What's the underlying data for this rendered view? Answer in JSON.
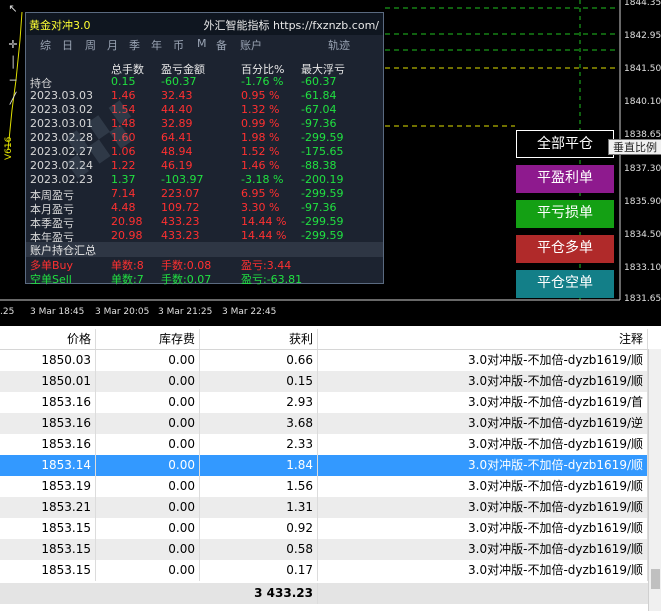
{
  "chart": {
    "price_axis": [
      "1844.35",
      "1842.95",
      "1841.50",
      "1840.10",
      "1838.65",
      "1837.30",
      "1835.90",
      "1834.50",
      "1833.10",
      "1831.65"
    ],
    "time_axis": [
      ".25",
      "3 Mar 18:45",
      "3 Mar 20:05",
      "3 Mar 21:25",
      "3 Mar 22:45"
    ],
    "vertical_label": "V616"
  },
  "panel": {
    "title": "黄金对冲3.0",
    "brand": "外汇智能指标 https://fxznzb.com/",
    "tabs": [
      "综",
      "日",
      "周",
      "月",
      "季",
      "年",
      "币",
      "M",
      "备",
      "账户",
      "轨迹"
    ],
    "headers": [
      "总手数",
      "盈亏金额",
      "百分比%",
      "最大浮亏"
    ],
    "position_label": "持仓",
    "rows": [
      {
        "label": "持仓",
        "lots": "0.15",
        "pnl": "-60.37",
        "pct": "-1.76 %",
        "maxdd": "-60.37",
        "color": "green"
      },
      {
        "label": "2023.03.03",
        "lots": "1.46",
        "pnl": "32.43",
        "pct": "0.95 %",
        "maxdd": "-61.84",
        "color": "red"
      },
      {
        "label": "2023.03.02",
        "lots": "1.54",
        "pnl": "44.40",
        "pct": "1.32 %",
        "maxdd": "-67.04",
        "color": "red"
      },
      {
        "label": "2023.03.01",
        "lots": "1.48",
        "pnl": "32.89",
        "pct": "0.99 %",
        "maxdd": "-97.36",
        "color": "red"
      },
      {
        "label": "2023.02.28",
        "lots": "1.60",
        "pnl": "64.41",
        "pct": "1.98 %",
        "maxdd": "-299.59",
        "color": "red"
      },
      {
        "label": "2023.02.27",
        "lots": "1.06",
        "pnl": "48.94",
        "pct": "1.52 %",
        "maxdd": "-175.65",
        "color": "red"
      },
      {
        "label": "2023.02.24",
        "lots": "1.22",
        "pnl": "46.19",
        "pct": "1.46 %",
        "maxdd": "-88.38",
        "color": "red"
      },
      {
        "label": "2023.02.23",
        "lots": "1.37",
        "pnl": "-103.97",
        "pct": "-3.18 %",
        "maxdd": "-200.19",
        "color": "green"
      },
      {
        "label": "本周盈亏",
        "lots": "7.14",
        "pnl": "223.07",
        "pct": "6.95 %",
        "maxdd": "-299.59",
        "color": "red"
      },
      {
        "label": "本月盈亏",
        "lots": "4.48",
        "pnl": "109.72",
        "pct": "3.30 %",
        "maxdd": "-97.36",
        "color": "red"
      },
      {
        "label": "本季盈亏",
        "lots": "20.98",
        "pnl": "433.23",
        "pct": "14.44 %",
        "maxdd": "-299.59",
        "color": "red"
      },
      {
        "label": "本年盈亏",
        "lots": "20.98",
        "pnl": "433.23",
        "pct": "14.44 %",
        "maxdd": "-299.59",
        "color": "red"
      }
    ],
    "summary_title": "账户持仓汇总",
    "buy": {
      "label": "多单Buy",
      "count": "单数:8",
      "lots": "手数:0.08",
      "pnl": "盈亏:3.44"
    },
    "sell": {
      "label": "空单Sell",
      "count": "单数:7",
      "lots": "手数:0.07",
      "pnl": "盈亏:-63.81"
    }
  },
  "buttons": {
    "close_all": "全部平仓",
    "close_profit": "平盈利单",
    "close_loss": "平亏损单",
    "close_buy": "平仓多单",
    "close_sell": "平仓空单"
  },
  "tooltip": "垂直比例",
  "grid": {
    "headers": [
      "价格",
      "库存费",
      "获利",
      "注释"
    ],
    "rows": [
      [
        "1850.03",
        "0.00",
        "0.66",
        "3.0对冲版-不加倍-dyzb1619/顺"
      ],
      [
        "1850.01",
        "0.00",
        "0.15",
        "3.0对冲版-不加倍-dyzb1619/顺"
      ],
      [
        "1853.16",
        "0.00",
        "2.93",
        "3.0对冲版-不加倍-dyzb1619/首"
      ],
      [
        "1853.16",
        "0.00",
        "3.68",
        "3.0对冲版-不加倍-dyzb1619/逆"
      ],
      [
        "1853.16",
        "0.00",
        "2.33",
        "3.0对冲版-不加倍-dyzb1619/顺"
      ],
      [
        "1853.14",
        "0.00",
        "1.84",
        "3.0对冲版-不加倍-dyzb1619/顺"
      ],
      [
        "1853.19",
        "0.00",
        "1.56",
        "3.0对冲版-不加倍-dyzb1619/顺"
      ],
      [
        "1853.21",
        "0.00",
        "1.31",
        "3.0对冲版-不加倍-dyzb1619/顺"
      ],
      [
        "1853.15",
        "0.00",
        "0.92",
        "3.0对冲版-不加倍-dyzb1619/顺"
      ],
      [
        "1853.15",
        "0.00",
        "0.58",
        "3.0对冲版-不加倍-dyzb1619/顺"
      ],
      [
        "1853.15",
        "0.00",
        "0.17",
        "3.0对冲版-不加倍-dyzb1619/顺"
      ]
    ],
    "selected_index": 5,
    "total": "3 433.23"
  },
  "colors": {
    "close_all": "#000000",
    "close_profit": "#8e1a8e",
    "close_loss": "#14a014",
    "close_buy": "#b02a2a",
    "close_sell": "#137f88"
  }
}
